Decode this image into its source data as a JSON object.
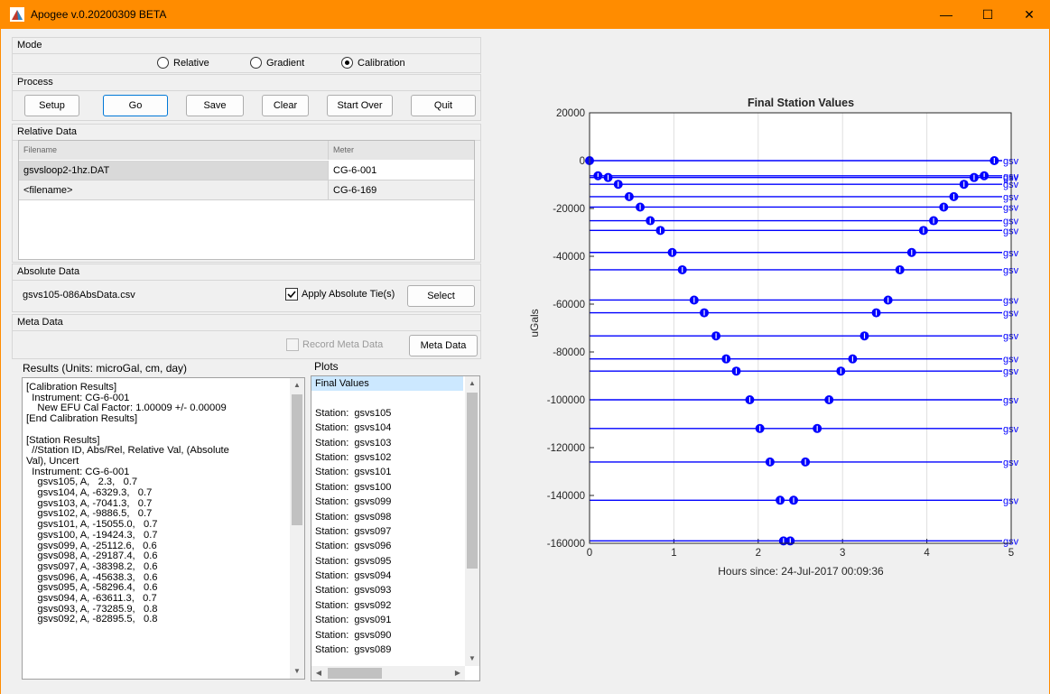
{
  "window": {
    "title": "Apogee v.0.20200309 BETA",
    "minimize_glyph": "—",
    "maximize_glyph": "☐",
    "close_glyph": "✕"
  },
  "mode": {
    "title": "Mode",
    "options": [
      {
        "label": "Relative",
        "selected": false
      },
      {
        "label": "Gradient",
        "selected": false
      },
      {
        "label": "Calibration",
        "selected": true
      }
    ]
  },
  "process": {
    "title": "Process",
    "buttons": [
      "Setup",
      "Go",
      "Save",
      "Clear",
      "Start Over",
      "Quit"
    ]
  },
  "relative_data": {
    "title": "Relative Data",
    "columns": [
      "Filename",
      "Meter"
    ],
    "rows": [
      {
        "filename": "gsvsloop2-1hz.DAT",
        "meter": "CG-6-001"
      },
      {
        "filename": "<filename>",
        "meter": "CG-6-169"
      }
    ]
  },
  "absolute_data": {
    "title": "Absolute Data",
    "file": "gsvs105-086AbsData.csv",
    "apply_label": "Apply Absolute Tie(s)",
    "apply_checked": true,
    "select_label": "Select"
  },
  "meta_data": {
    "title": "Meta Data",
    "record_label": "Record Meta Data",
    "record_checked": false,
    "button_label": "Meta Data"
  },
  "results": {
    "label": "Results (Units:  microGal, cm, day)",
    "lines": [
      "[Calibration Results]",
      "  Instrument: CG-6-001",
      "    New EFU Cal Factor: 1.00009 +/- 0.00009",
      "[End Calibration Results]",
      "",
      "[Station Results]",
      "  //Station ID, Abs/Rel, Relative Val, (Absolute",
      "Val), Uncert",
      "  Instrument: CG-6-001",
      "    gsvs105, A,   2.3,   0.7",
      "    gsvs104, A, -6329.3,   0.7",
      "    gsvs103, A, -7041.3,   0.7",
      "    gsvs102, A, -9886.5,   0.7",
      "    gsvs101, A, -15055.0,   0.7",
      "    gsvs100, A, -19424.3,   0.7",
      "    gsvs099, A, -25112.6,   0.6",
      "    gsvs098, A, -29187.4,   0.6",
      "    gsvs097, A, -38398.2,   0.6",
      "    gsvs096, A, -45638.3,   0.6",
      "    gsvs095, A, -58296.4,   0.6",
      "    gsvs094, A, -63611.3,   0.7",
      "    gsvs093, A, -73285.9,   0.8",
      "    gsvs092, A, -82895.5,   0.8"
    ]
  },
  "plots": {
    "label": "Plots",
    "items": [
      "Final Values",
      "",
      "Station:  gsvs105",
      "Station:  gsvs104",
      "Station:  gsvs103",
      "Station:  gsvs102",
      "Station:  gsvs101",
      "Station:  gsvs100",
      "Station:  gsvs099",
      "Station:  gsvs098",
      "Station:  gsvs097",
      "Station:  gsvs096",
      "Station:  gsvs095",
      "Station:  gsvs094",
      "Station:  gsvs093",
      "Station:  gsvs092",
      "Station:  gsvs091",
      "Station:  gsvs090",
      "Station:  gsvs089"
    ],
    "selected_index": 0
  },
  "chart_data": {
    "type": "scatter",
    "title": "Final Station Values",
    "xlabel": "Hours since: 24-Jul-2017 00:09:36",
    "ylabel": "uGals",
    "xlim": [
      0,
      5
    ],
    "ylim": [
      -160000,
      20000
    ],
    "xticks": [
      "0",
      "1",
      "2",
      "3",
      "4",
      "5"
    ],
    "yticks": [
      "20000",
      "0",
      "-20000",
      "-40000",
      "-60000",
      "-80000",
      "-100000",
      "-120000",
      "-140000",
      "-160000"
    ],
    "grid": true,
    "series_color": "#0000ff",
    "line_label": "gsv",
    "stations": [
      {
        "value": 2.3,
        "x": [
          0.0,
          4.8
        ]
      },
      {
        "value": -6329.3,
        "x": [
          0.1,
          4.68
        ]
      },
      {
        "value": -7041.3,
        "x": [
          0.22,
          4.56
        ]
      },
      {
        "value": -9886.5,
        "x": [
          0.34,
          4.44
        ]
      },
      {
        "value": -15055.0,
        "x": [
          0.47,
          4.32
        ]
      },
      {
        "value": -19424.3,
        "x": [
          0.6,
          4.2
        ]
      },
      {
        "value": -25112.6,
        "x": [
          0.72,
          4.08
        ]
      },
      {
        "value": -29187.4,
        "x": [
          0.84,
          3.96
        ]
      },
      {
        "value": -38398.2,
        "x": [
          0.98,
          3.82
        ]
      },
      {
        "value": -45638.3,
        "x": [
          1.1,
          3.68
        ]
      },
      {
        "value": -58296.4,
        "x": [
          1.24,
          3.54
        ]
      },
      {
        "value": -63611.3,
        "x": [
          1.36,
          3.4
        ]
      },
      {
        "value": -73285.9,
        "x": [
          1.5,
          3.26
        ]
      },
      {
        "value": -82895.5,
        "x": [
          1.62,
          3.12
        ]
      },
      {
        "value": -88000,
        "x": [
          1.74,
          2.98
        ]
      },
      {
        "value": -100000,
        "x": [
          1.9,
          2.84
        ]
      },
      {
        "value": -112000,
        "x": [
          2.02,
          2.7
        ]
      },
      {
        "value": -126000,
        "x": [
          2.14,
          2.56
        ]
      },
      {
        "value": -142000,
        "x": [
          2.26,
          2.42
        ]
      },
      {
        "value": -159000,
        "x": [
          2.3,
          2.38
        ]
      }
    ]
  }
}
